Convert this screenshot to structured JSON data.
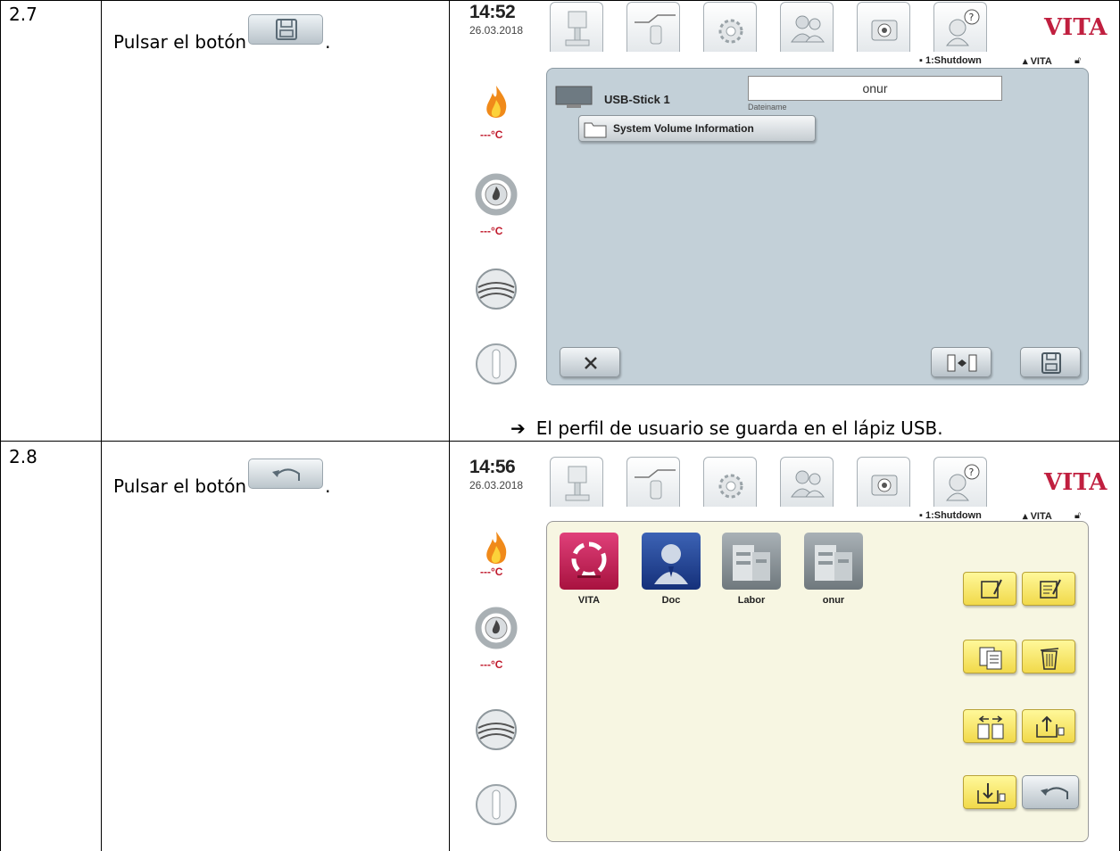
{
  "steps": [
    {
      "number": "2.7",
      "instruction_prefix": "Pulsar el botón",
      "instruction_suffix": ".",
      "instruction_button_icon": "save-icon",
      "result_arrow": "➔",
      "result_text": "El perfil de usuario se guarda en el lápiz USB.",
      "screen": {
        "time": "14:52",
        "date": "26.03.2018",
        "brand": "VITA",
        "status_shutdown": "1:Shutdown",
        "status_user": "VITA",
        "temp_top": "---°C",
        "temp_middle": "---°C",
        "usb_label": "USB-Stick 1",
        "filename_value": "onur",
        "filename_caption": "Dateiname",
        "folder_label": "System Volume Information"
      }
    },
    {
      "number": "2.8",
      "instruction_prefix": "Pulsar el botón",
      "instruction_suffix": ".",
      "instruction_button_icon": "back-arrow-icon",
      "screen": {
        "time": "14:56",
        "date": "26.03.2018",
        "brand": "VITA",
        "status_shutdown": "1:Shutdown",
        "status_user": "VITA",
        "temp_top": "---°C",
        "temp_middle": "---°C",
        "profiles": [
          "VITA",
          "Doc",
          "Labor",
          "onur"
        ]
      }
    }
  ],
  "colors": {
    "brand_red": "#c01f3f",
    "panel_blue": "#c3d0d8",
    "panel_yellow": "#f7f6e2",
    "button_yellow": "#f6e46a",
    "profile_vita": "#c2185b",
    "profile_doc": "#1f3f8f",
    "profile_grey": "#8e979c"
  }
}
